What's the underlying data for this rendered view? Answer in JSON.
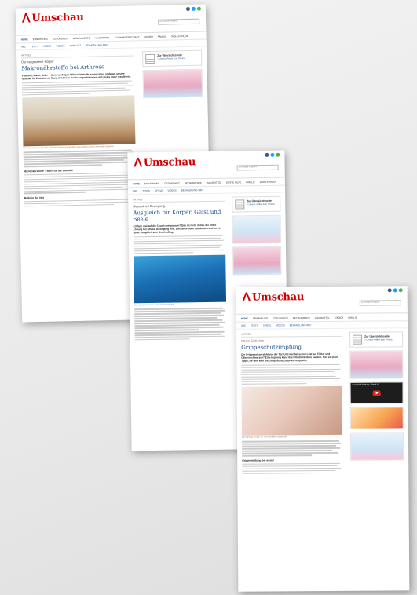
{
  "pages": [
    {
      "logo_text": "Umschau",
      "topline": "",
      "search_placeholder": "Suchbegriff eingeben",
      "nav": [
        "HOME",
        "ERNÄHRUNG",
        "GESUNDHEIT",
        "MEDIKAMENTE",
        "HAUSMITTEL",
        "SCHWANGERSCHAFT",
        "KINDER",
        "FAMILIE",
        "WOHLFÜHLEN"
      ],
      "subnav": [
        "ABC",
        "TESTS",
        "SPIELE",
        "VIDEOS",
        "PODCAST",
        "BEHANDLUNG ABC"
      ],
      "rubric": "ARTIKEL",
      "kicker": "Der vergessene Körper",
      "title": "Makronährstoffe bei Arthrose",
      "lead": "Vitamine, Eisen, Salze – diese wichtigen Mikronährstoffe haben unser anderem unsere Gelenke fit. Entsteht ein Mangel, können Verdauungsstörungen und vieles mehr resultieren.",
      "caption": "Mit Vitamingabe gegenüber Arthrose Vorbeugung der Mikronährstoffe ist jedes Lebensalter geeignet.",
      "h2a": "Mikronährstoffe – auch für die Gelenke",
      "h2b": "Rolle in der Not",
      "overview_title": "Zur Übersichtsseite",
      "overview_link": "» Unsere Artikel zum Thema"
    },
    {
      "logo_text": "Umschau",
      "topline": "",
      "search_placeholder": "Suchbegriff eingeben",
      "nav": [
        "HOME",
        "ERNÄHRUNG",
        "GESUNDHEIT",
        "MEDIKAMENTE",
        "HAUSMITTEL",
        "ERSTE HILFE",
        "FAMILIE",
        "WOHLFÜHLEN"
      ],
      "subnav": [
        "ABC",
        "TESTS",
        "SPIELE",
        "VIDEOS",
        "BEHANDLUNG ABC"
      ],
      "rubric": "ARTIKEL",
      "kicker": "Gesundheit Bewegung",
      "title": "Ausgleich für Körper, Geist und Seele",
      "lead": "Einfach mal auf die Couch entspannen? Das ist nicht immer die beste Lösung bei Stress. Bewegung hilft, Stresshormone abzubauen und ist ein guter Ausgleich zum Berufsalltag.",
      "caption": "Bewegung im Wasser entlastet die Gelenke.",
      "overview_title": "Zur Übersichtsseite",
      "overview_link": "» Unsere Artikel zum Thema"
    },
    {
      "logo_text": "Umschau",
      "topline": "",
      "search_placeholder": "Suchbegriff eingeben",
      "nav": [
        "HOME",
        "ERNÄHRUNG",
        "GESUNDHEIT",
        "MEDIKAMENTE",
        "HAUSMITTEL",
        "KINDER",
        "FAMILIE"
      ],
      "subnav": [
        "ABC",
        "TESTS",
        "SPIELE",
        "VIDEOS",
        "BEHANDLUNG ABC"
      ],
      "rubric": "ARTIKEL",
      "kicker": "Kleine Einheiten",
      "title": "Grippeschutzimpfung",
      "lead": "Die Grippesaison steht vor der Tür. Und wer hat schon Lust auf Fieber und Gliederschmerzen? Eine Impfung kann das Infektionsrisiko senken. Hier ein paar Tipps, für wen sich die Grippeschutzimpfung empfiehlt.",
      "caption": "Die Impfung schützt vor den aktuellen Grippeviren.",
      "h2a": "Grippeimpfung bei wem?",
      "video_title": "Schwindel Impfung - Gerät & ...",
      "overview_title": "Zur Übersichtsseite",
      "overview_link": "» Unsere Artikel zum Thema"
    }
  ],
  "colors": {
    "brand": "#d40000",
    "link": "#1a4c8f",
    "social": [
      "#3b5998",
      "#1da1f2",
      "#4caf50"
    ]
  }
}
